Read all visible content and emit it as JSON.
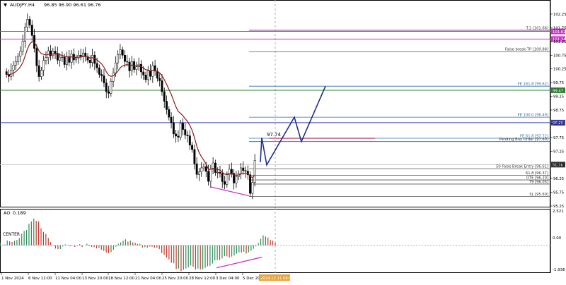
{
  "header": {
    "symbol": "AUDJPY,H4",
    "ohlc": "96.85 96.90 96.61 96.76"
  },
  "chart_data": {
    "type": "candlestick",
    "ylim": [
      95.25,
      102.25
    ],
    "yticks": [
      "102.25",
      "101.75",
      "101.25",
      "100.75",
      "100.25",
      "99.75",
      "99.25",
      "98.75",
      "98.25",
      "97.75",
      "97.25",
      "96.75",
      "96.25",
      "95.75",
      "95.25"
    ],
    "xlabels": [
      "1 Nov 2024",
      "6 Nov 12:00",
      "11 Nov 04:00",
      "13 Nov 20:00",
      "18 Nov 12:00",
      "21 Nov 04:00",
      "25 Nov 20:00",
      "28 Nov 12:00",
      "3 Dec 04:00",
      "5 Dec 20:00"
    ],
    "cursor_time": "2024.12.11 08:00",
    "current_price": 96.76,
    "price_tags": {
      "magenta_top": "101.62",
      "magenta_second": "101.34",
      "green": "99.47",
      "blue": "98.29",
      "current": "96.76"
    },
    "close": [
      100.05,
      99.98,
      100.21,
      100.39,
      100.52,
      100.71,
      100.9,
      101.26,
      101.78,
      102.06,
      101.85,
      101.47,
      101.0,
      100.37,
      99.97,
      100.2,
      100.56,
      100.66,
      100.91,
      100.74,
      100.9,
      100.82,
      100.57,
      100.68,
      100.68,
      100.41,
      100.7,
      100.49,
      100.79,
      100.58,
      100.65,
      100.75,
      100.71,
      100.83,
      100.7,
      100.57,
      100.48,
      100.75,
      100.45,
      100.29,
      100.05,
      100.0,
      99.74,
      99.42,
      99.36,
      99.8,
      100.11,
      100.47,
      100.78,
      100.95,
      100.75,
      100.52,
      100.5,
      100.18,
      100.52,
      100.23,
      100.33,
      100.42,
      100.14,
      100.03,
      99.86,
      100.18,
      99.98,
      100.37,
      100.17,
      99.91,
      99.82,
      99.42,
      99.07,
      98.77,
      98.49,
      98.29,
      97.88,
      97.8,
      97.76,
      98.27,
      98.04,
      97.84,
      97.81,
      97.47,
      97.31,
      96.79,
      96.4,
      96.49,
      96.64,
      96.68,
      96.51,
      96.15,
      96.59,
      96.82,
      96.47,
      96.48,
      96.44,
      96.14,
      96.04,
      96.39,
      96.59,
      96.44,
      96.09,
      96.32,
      96.43,
      96.64,
      96.54,
      96.52,
      96.39,
      95.71,
      96.11,
      96.91
    ],
    "ema": [
      100.05,
      100.04,
      100.06,
      100.1,
      100.15,
      100.23,
      100.33,
      100.48,
      100.71,
      100.97,
      101.16,
      101.24,
      101.21,
      101.09,
      100.91,
      100.81,
      100.78,
      100.76,
      100.78,
      100.78,
      100.79,
      100.8,
      100.77,
      100.76,
      100.75,
      100.7,
      100.7,
      100.67,
      100.69,
      100.67,
      100.67,
      100.68,
      100.68,
      100.7,
      100.7,
      100.68,
      100.65,
      100.66,
      100.63,
      100.58,
      100.51,
      100.43,
      100.31,
      100.15,
      100.02,
      99.98,
      100.0,
      100.07,
      100.17,
      100.29,
      100.36,
      100.39,
      100.41,
      100.37,
      100.39,
      100.37,
      100.36,
      100.37,
      100.34,
      100.29,
      100.22,
      100.21,
      100.18,
      100.2,
      100.2,
      100.16,
      100.11,
      100.0,
      99.86,
      99.69,
      99.5,
      99.32,
      99.09,
      98.87,
      98.7,
      98.63,
      98.54,
      98.43,
      98.34,
      98.19,
      98.01,
      97.74,
      97.43,
      97.2,
      97.05,
      96.92,
      96.78,
      96.59,
      96.59,
      96.62,
      96.6,
      96.58,
      96.56,
      96.48,
      96.41,
      96.41,
      96.43,
      96.43,
      96.38,
      96.37,
      96.38,
      96.42,
      96.44,
      96.45,
      96.44,
      96.33,
      96.29,
      96.38
    ],
    "horizontal_levels": [
      {
        "label": "T.2 [101.66]",
        "value": 101.66
      },
      {
        "label": "False break TP [100.88]",
        "value": 100.88
      },
      {
        "label": "FE 161.8 [99.62]",
        "value": 99.62
      },
      {
        "label": "FE 100.0 [98.49]",
        "value": 98.49
      },
      {
        "label": "FE 61.8 [97.72]",
        "value": 97.72
      },
      {
        "label": "Pending Buy Order [97.60]",
        "value": 97.6
      },
      {
        "label": "50 False Break Entry [96.61]",
        "value": 96.61
      },
      {
        "label": "61.8 [96.37]",
        "value": 96.37
      },
      {
        "label": "OTE [96.20]",
        "value": 96.2
      },
      {
        "label": "79 [96.05]",
        "value": 96.05
      },
      {
        "label": "SL [95.60]",
        "value": 95.6
      }
    ],
    "annotation_high": "97.74",
    "indicator": {
      "name": "AO",
      "value": "0.189",
      "center_label": "CENTER",
      "ytick_top": "2.521",
      "ytick_zero": "0.00",
      "ytick_bottom": "-1.936",
      "ylim": [
        -1.936,
        2.521
      ],
      "values": [
        0.21,
        0.03,
        0.06,
        0.35,
        0.29,
        0.24,
        0.32,
        0.38,
        0.53,
        0.83,
        1.04,
        1.1,
        1.55,
        1.71,
        1.92,
        1.76,
        1.72,
        1.23,
        0.97,
        0.82,
        0.53,
        0.23,
        -0.03,
        -0.23,
        -0.27,
        -0.26,
        -0.07,
        0.07,
        0.02,
        -0.07,
        0.02,
        -0.12,
        -0.03,
        0.08,
        -0.12,
        -0.0,
        0.12,
        -0.06,
        -0.12,
        -0.13,
        -0.22,
        -0.19,
        -0.31,
        -0.41,
        -0.52,
        -0.57,
        -0.49,
        -0.32,
        -0.1,
        0.12,
        0.21,
        0.33,
        0.43,
        0.27,
        0.34,
        0.21,
        0.19,
        0.11,
        0.11,
        -0.16,
        -0.13,
        -0.16,
        -0.09,
        -0.11,
        -0.17,
        -0.18,
        -0.27,
        -0.56,
        -0.69,
        -0.89,
        -1.01,
        -1.25,
        -1.29,
        -1.7,
        -1.67,
        -1.86,
        -1.76,
        -1.67,
        -1.58,
        -1.44,
        -1.53,
        -1.73,
        -1.67,
        -1.73,
        -1.73,
        -1.62,
        -1.51,
        -1.47,
        -1.31,
        -1.08,
        -1.05,
        -1.06,
        -0.94,
        -0.78,
        -0.79,
        -0.88,
        -0.81,
        -0.73,
        -0.6,
        -0.51,
        -0.52,
        -0.47,
        -0.59,
        -0.5,
        -0.39,
        -0.25,
        -0.07,
        0.16,
        0.47,
        0.72,
        0.63,
        0.56,
        0.38,
        0.34,
        0.19
      ]
    }
  }
}
